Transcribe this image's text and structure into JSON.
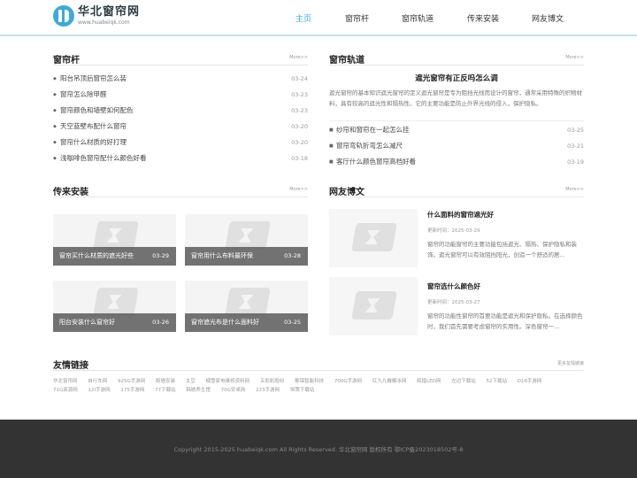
{
  "brand": {
    "title": "华北窗帘网",
    "subtitle": "www.huabeiqk.com"
  },
  "nav": [
    {
      "label": "主页"
    },
    {
      "label": "窗帘杆"
    },
    {
      "label": "窗帘轨道"
    },
    {
      "label": "传来安装"
    },
    {
      "label": "网友博文"
    }
  ],
  "more": "More>>",
  "s1": {
    "title": "窗帘杆",
    "items": [
      {
        "text": "阳台吊顶后窗帘怎么装",
        "date": "03-24"
      },
      {
        "text": "窗帘怎么除甲醛",
        "date": "03-23"
      },
      {
        "text": "窗帘颜色和墙壁如何配色",
        "date": "03-23"
      },
      {
        "text": "天空蓝壁布配什么窗帘",
        "date": "03-20"
      },
      {
        "text": "窗帘什么材质的好打理",
        "date": "03-20"
      },
      {
        "text": "浅咖啡色窗帘配什么颜色好看",
        "date": "03-18"
      }
    ]
  },
  "s2": {
    "title": "窗帘轨道",
    "feature_title": "遮光窗帘有正反吗怎么调",
    "feature_desc": "遮光窗帘的基本知识遮光窗帘的定义遮光窗帘是专为阻挡光线而设计的窗帘，通常采用特殊的织物材料，具有较高的遮光性和隔热性。它的主要功能是防止外界光线的侵入，保护隐私。",
    "items": [
      {
        "text": "纱帘和窗帘在一起怎么挂",
        "date": "03-25"
      },
      {
        "text": "窗帘弯轨折弯怎么减尺",
        "date": "03-21"
      },
      {
        "text": "客厅什么颜色窗帘高档好看",
        "date": "03-19"
      }
    ]
  },
  "s3": {
    "title": "传来安装",
    "items": [
      {
        "text": "窗帘买什么材质的遮光好些",
        "date": "03-29"
      },
      {
        "text": "窗帘用什么布料最环保",
        "date": "03-28"
      },
      {
        "text": "阳台安装什么窗帘好",
        "date": "03-26"
      },
      {
        "text": "窗帘遮光布是什么面料好",
        "date": "03-25"
      }
    ]
  },
  "s4": {
    "title": "网友博文",
    "items": [
      {
        "title": "什么面料的窗帘遮光好",
        "meta": "更新时间：2025-03-29",
        "desc": "窗帘的功能窗帘的主要功能包括遮光、隔热、保护隐私和装饰。遮光窗帘可以有效阻挡阳光，创造一个舒适的居..."
      },
      {
        "title": "窗帘选什么颜色好",
        "meta": "更新时间：2025-03-27",
        "desc": "窗帘的功能性窗帘的首要功能是遮光和保护隐私。在选择颜色时，我们首先需要考虑窗帘的实用性。深色窗帘一..."
      }
    ]
  },
  "links": {
    "title": "友情链接",
    "more": "更多友情链接",
    "items": [
      "华北窗帘网",
      "自行车网",
      "92SG手游网",
      "断墙安装",
      "太豆",
      "楠雪家电维修资料网",
      "五彩彩脸纷",
      "鄢锦智能科技",
      "700G手游网",
      "红九九機模冰网",
      "辉煌LED网",
      "左边下载站",
      "52下载站",
      "D16手游网",
      "71G资源网",
      "12I手游网",
      "175手游网",
      "77下载站",
      "韩她养生馆",
      "70G安卓网",
      "223手游网",
      "恒策下载站"
    ]
  },
  "footer": {
    "copyright": "Copyright 2015-2025 huabeiqk.com All Rights Reserved. 华北窗帘网 版权所有 鄂ICP备2023018502号-8"
  },
  "colors": {
    "accent": "#3fa9d8",
    "footer_bg": "#333333"
  },
  "icons": {
    "logo": "curtain-logo-icon",
    "bullet": "diamond-bullet-icon",
    "placeholder": "image-placeholder-icon"
  }
}
